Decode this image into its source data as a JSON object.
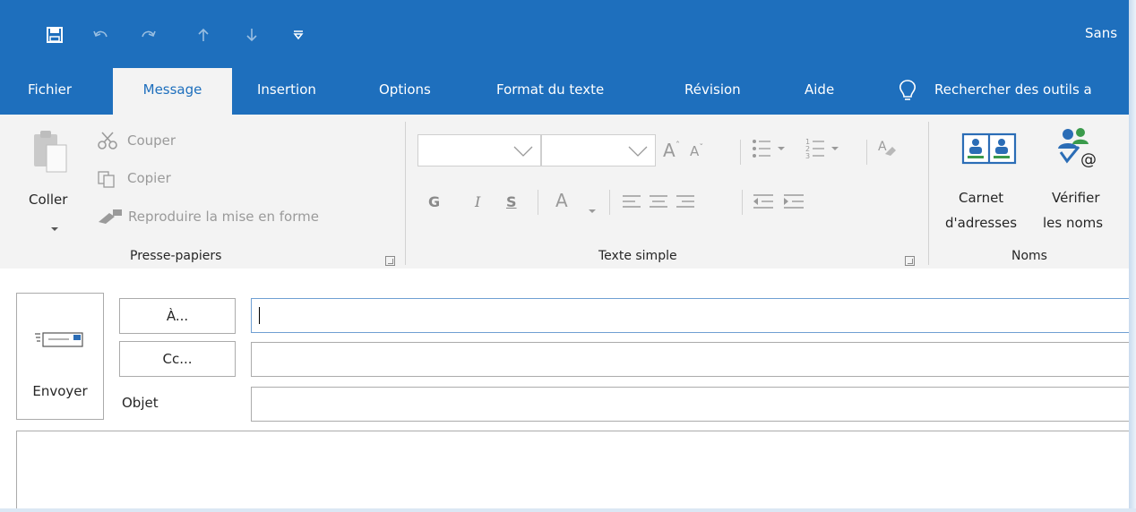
{
  "title_bar": {
    "title": "Sans"
  },
  "quick_access": [
    "save-icon",
    "undo-icon",
    "redo-icon",
    "up-arrow-icon",
    "down-arrow-icon",
    "customize-icon"
  ],
  "tabs": [
    {
      "label": "Fichier"
    },
    {
      "label": "Message",
      "active": true
    },
    {
      "label": "Insertion"
    },
    {
      "label": "Options"
    },
    {
      "label": "Format du texte"
    },
    {
      "label": "Révision"
    },
    {
      "label": "Aide"
    }
  ],
  "tell_me": "Rechercher des outils a",
  "clipboard": {
    "paste": "Coller",
    "cut": "Couper",
    "copy": "Copier",
    "format_painter": "Reproduire la mise en forme",
    "group": "Presse-papiers"
  },
  "basic_text": {
    "bold": "G",
    "italic": "I",
    "underline": "S",
    "font_color": "A",
    "group": "Texte simple"
  },
  "names": {
    "address_book_1": "Carnet",
    "address_book_2": "d'adresses",
    "check_names_1": "Vérifier",
    "check_names_2": "les noms",
    "group": "Noms"
  },
  "compose": {
    "send": "Envoyer",
    "to": "À...",
    "cc": "Cc...",
    "subject": "Objet",
    "to_value": "",
    "cc_value": "",
    "subject_value": ""
  },
  "colors": {
    "accent": "#1e6fbd",
    "ribbon_bg": "#f3f3f3"
  }
}
